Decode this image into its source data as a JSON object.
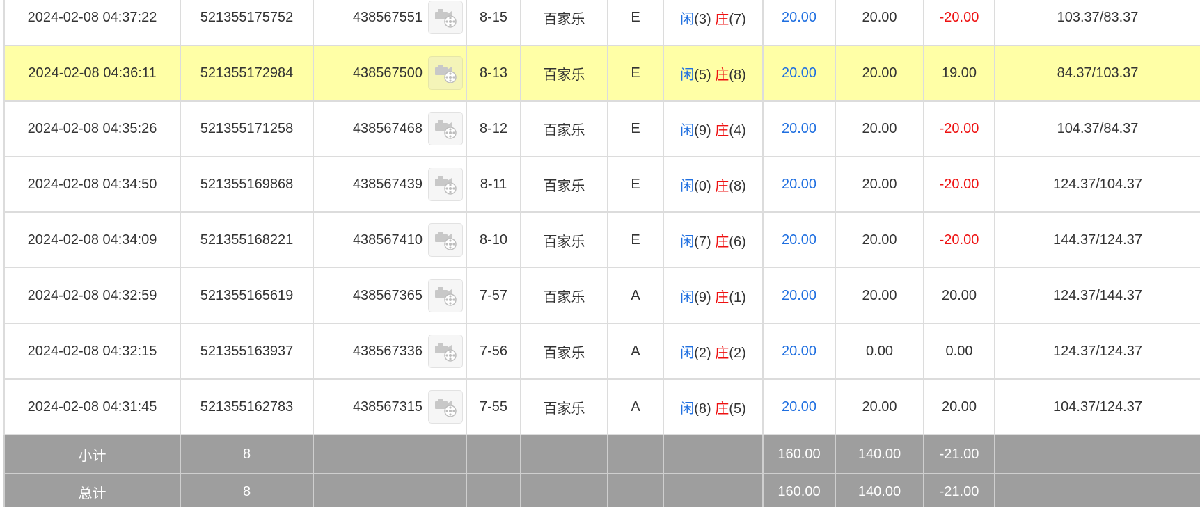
{
  "rows": [
    {
      "time": "2024-02-08 04:37:22",
      "order_no": "521355175752",
      "round_no": "438567551",
      "shoe": "8-15",
      "game": "百家乐",
      "table": "E",
      "player_label": "闲",
      "player_score": "(3)",
      "banker_label": "庄",
      "banker_score": "(7)",
      "bet": "20.00",
      "valid_bet": "20.00",
      "win_loss": "-20.00",
      "win_loss_sign": "neg",
      "balance": "103.37/83.37",
      "highlight": false
    },
    {
      "time": "2024-02-08 04:36:11",
      "order_no": "521355172984",
      "round_no": "438567500",
      "shoe": "8-13",
      "game": "百家乐",
      "table": "E",
      "player_label": "闲",
      "player_score": "(5)",
      "banker_label": "庄",
      "banker_score": "(8)",
      "bet": "20.00",
      "valid_bet": "20.00",
      "win_loss": "19.00",
      "win_loss_sign": "pos",
      "balance": "84.37/103.37",
      "highlight": true
    },
    {
      "time": "2024-02-08 04:35:26",
      "order_no": "521355171258",
      "round_no": "438567468",
      "shoe": "8-12",
      "game": "百家乐",
      "table": "E",
      "player_label": "闲",
      "player_score": "(9)",
      "banker_label": "庄",
      "banker_score": "(4)",
      "bet": "20.00",
      "valid_bet": "20.00",
      "win_loss": "-20.00",
      "win_loss_sign": "neg",
      "balance": "104.37/84.37",
      "highlight": false
    },
    {
      "time": "2024-02-08 04:34:50",
      "order_no": "521355169868",
      "round_no": "438567439",
      "shoe": "8-11",
      "game": "百家乐",
      "table": "E",
      "player_label": "闲",
      "player_score": "(0)",
      "banker_label": "庄",
      "banker_score": "(8)",
      "bet": "20.00",
      "valid_bet": "20.00",
      "win_loss": "-20.00",
      "win_loss_sign": "neg",
      "balance": "124.37/104.37",
      "highlight": false
    },
    {
      "time": "2024-02-08 04:34:09",
      "order_no": "521355168221",
      "round_no": "438567410",
      "shoe": "8-10",
      "game": "百家乐",
      "table": "E",
      "player_label": "闲",
      "player_score": "(7)",
      "banker_label": "庄",
      "banker_score": "(6)",
      "bet": "20.00",
      "valid_bet": "20.00",
      "win_loss": "-20.00",
      "win_loss_sign": "neg",
      "balance": "144.37/124.37",
      "highlight": false
    },
    {
      "time": "2024-02-08 04:32:59",
      "order_no": "521355165619",
      "round_no": "438567365",
      "shoe": "7-57",
      "game": "百家乐",
      "table": "A",
      "player_label": "闲",
      "player_score": "(9)",
      "banker_label": "庄",
      "banker_score": "(1)",
      "bet": "20.00",
      "valid_bet": "20.00",
      "win_loss": "20.00",
      "win_loss_sign": "pos",
      "balance": "124.37/144.37",
      "highlight": false
    },
    {
      "time": "2024-02-08 04:32:15",
      "order_no": "521355163937",
      "round_no": "438567336",
      "shoe": "7-56",
      "game": "百家乐",
      "table": "A",
      "player_label": "闲",
      "player_score": "(2)",
      "banker_label": "庄",
      "banker_score": "(2)",
      "bet": "20.00",
      "valid_bet": "0.00",
      "win_loss": "0.00",
      "win_loss_sign": "zero",
      "balance": "124.37/124.37",
      "highlight": false
    },
    {
      "time": "2024-02-08 04:31:45",
      "order_no": "521355162783",
      "round_no": "438567315",
      "shoe": "7-55",
      "game": "百家乐",
      "table": "A",
      "player_label": "闲",
      "player_score": "(8)",
      "banker_label": "庄",
      "banker_score": "(5)",
      "bet": "20.00",
      "valid_bet": "20.00",
      "win_loss": "20.00",
      "win_loss_sign": "pos",
      "balance": "104.37/124.37",
      "highlight": false
    }
  ],
  "subtotal": {
    "label": "小计",
    "count": "8",
    "bet": "160.00",
    "valid_bet": "140.00",
    "win_loss": "-21.00"
  },
  "total": {
    "label": "总计",
    "count": "8",
    "bet": "160.00",
    "valid_bet": "140.00",
    "win_loss": "-21.00"
  },
  "video_button_icon": "video-replay-icon",
  "colors": {
    "player": "#1f6fe0",
    "banker": "#ee1111",
    "negative": "#ee1111",
    "highlight_row": "#ffffa6",
    "summary_bg": "#9e9e9e"
  }
}
